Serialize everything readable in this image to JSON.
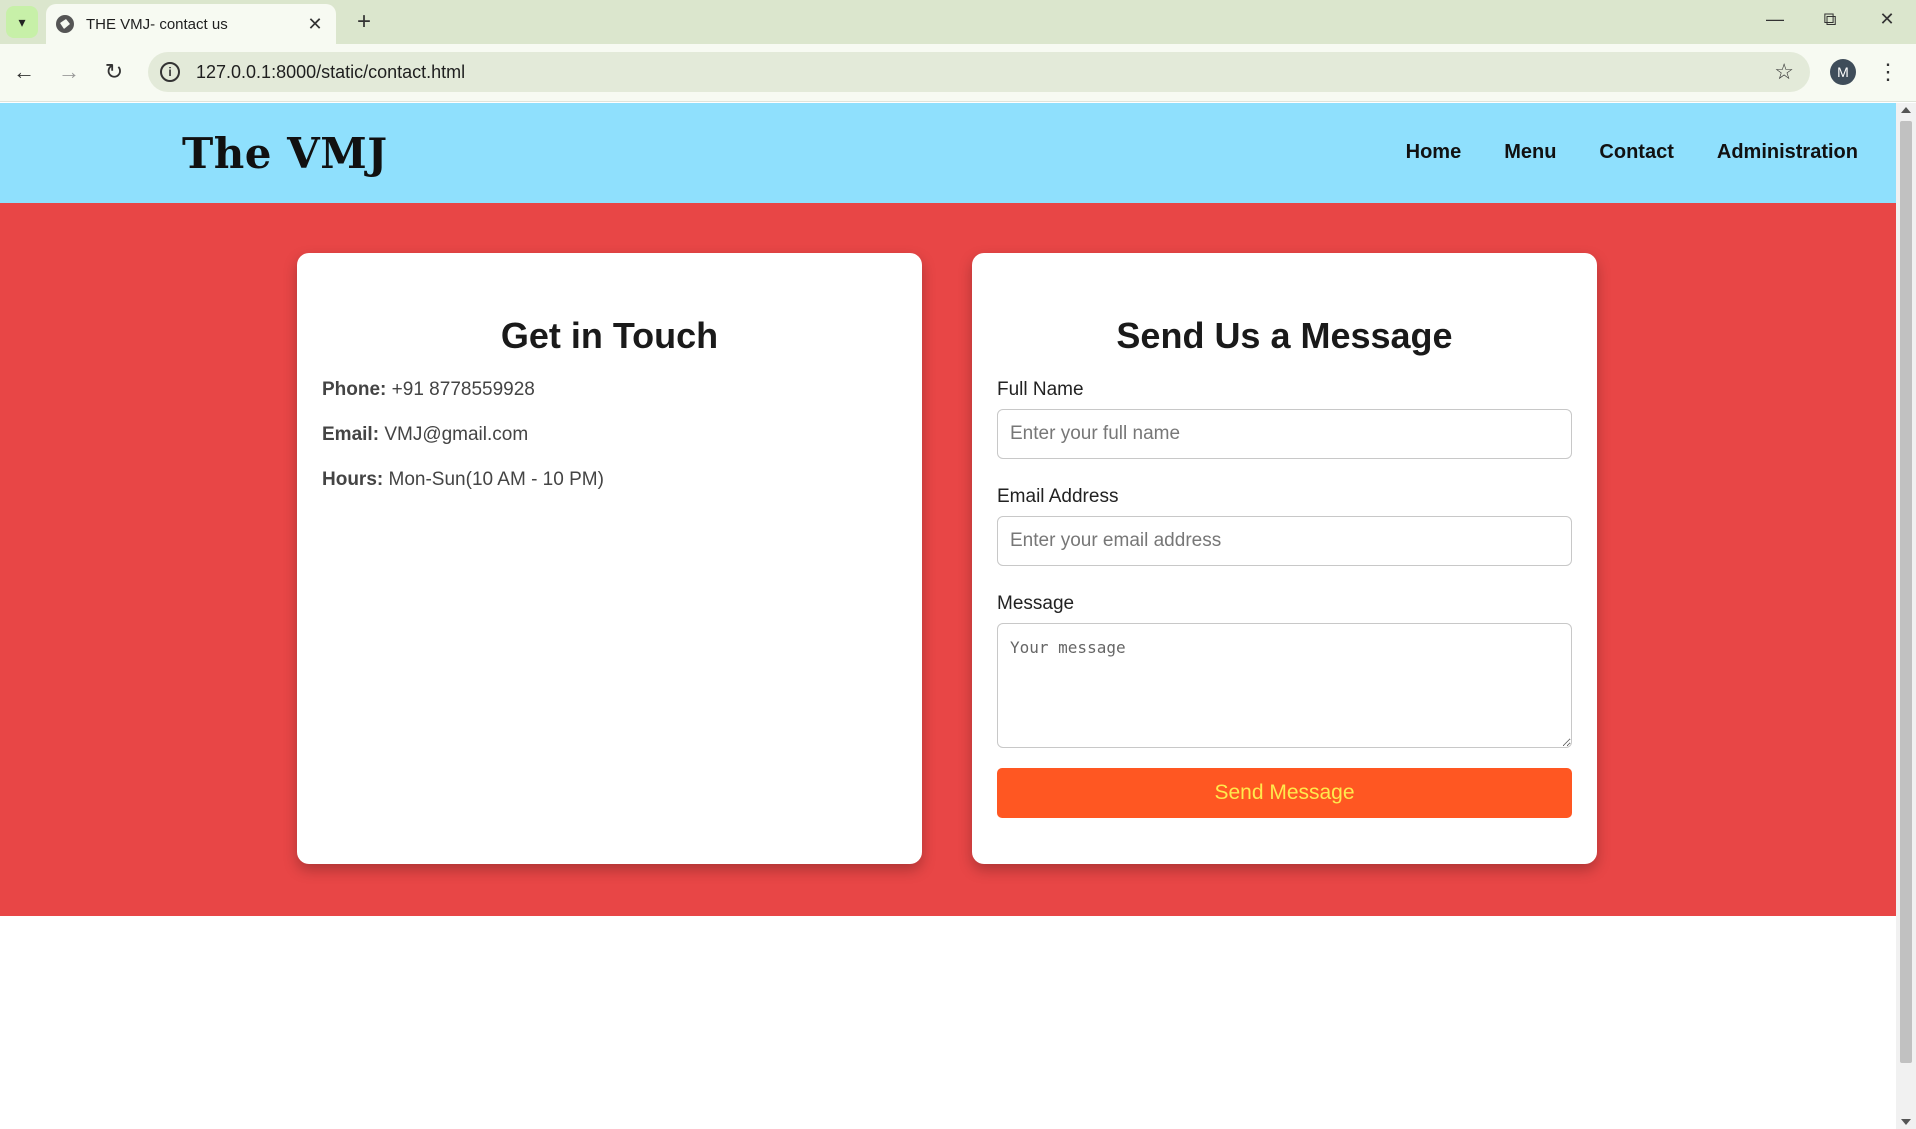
{
  "browser": {
    "tab_title": "THE VMJ- contact us",
    "url": "127.0.0.1:8000/static/contact.html",
    "profile_initial": "M"
  },
  "header": {
    "logo": "The VMJ",
    "nav": [
      "Home",
      "Menu",
      "Contact",
      "Administration"
    ]
  },
  "contact_info": {
    "title": "Get in Touch",
    "phone_label": "Phone:",
    "phone": "+91 8778559928",
    "email_label": "Email:",
    "email": "VMJ@gmail.com",
    "hours_label": "Hours:",
    "hours": "Mon-Sun(10 AM - 10 PM)"
  },
  "form": {
    "title": "Send Us a Message",
    "name_label": "Full Name",
    "name_placeholder": "Enter your full name",
    "email_label": "Email Address",
    "email_placeholder": "Enter your email address",
    "message_label": "Message",
    "message_placeholder": "Your message",
    "submit_label": "Send Message"
  },
  "colors": {
    "header_bg": "#8fe0fd",
    "band_bg": "#e84646",
    "button_bg": "#ff5722",
    "button_text": "#ffe94d"
  }
}
